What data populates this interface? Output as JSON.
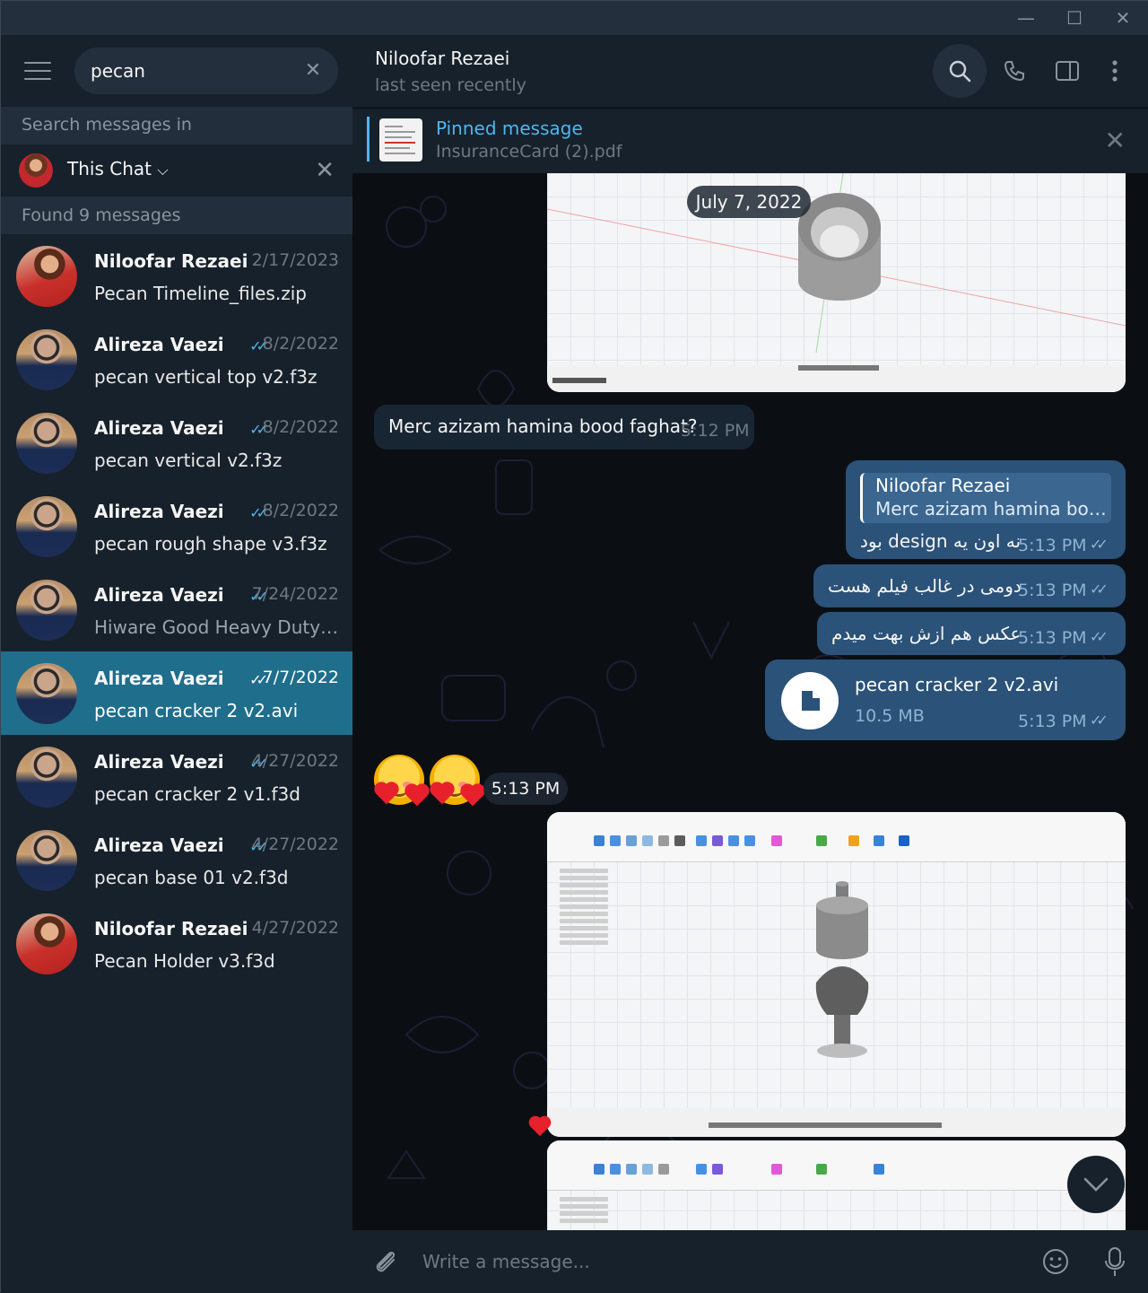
{
  "window": {
    "min": "—",
    "max": "☐",
    "close": "✕"
  },
  "search": {
    "query": "pecan"
  },
  "sidebar": {
    "search_in_label": "Search messages in",
    "scope_label": "This Chat",
    "found_label": "Found 9 messages",
    "results": [
      {
        "name": "Niloofar Rezaei",
        "date": "2/17/2023",
        "text": "Pecan Timeline_files.zip",
        "ticks": "",
        "avatar": "female"
      },
      {
        "name": "Alireza Vaezi",
        "date": "8/2/2022",
        "text": "pecan vertical top v2.f3z",
        "ticks": "✓✓",
        "avatar": "male"
      },
      {
        "name": "Alireza Vaezi",
        "date": "8/2/2022",
        "text": "pecan vertical v2.f3z",
        "ticks": "✓✓",
        "avatar": "male"
      },
      {
        "name": "Alireza Vaezi",
        "date": "8/2/2022",
        "text": "pecan rough shape v3.f3z",
        "ticks": "✓✓",
        "avatar": "male"
      },
      {
        "name": "Alireza Vaezi",
        "date": "7/24/2022",
        "text": "Hiware Good Heavy Duty Pecan Cracker...",
        "ticks": "✓✓",
        "avatar": "male"
      },
      {
        "name": "Alireza Vaezi",
        "date": "7/7/2022",
        "text": "pecan cracker 2 v2.avi",
        "ticks": "✓✓",
        "avatar": "male"
      },
      {
        "name": "Alireza Vaezi",
        "date": "4/27/2022",
        "text": "pecan cracker 2 v1.f3d",
        "ticks": "✓✓",
        "avatar": "male"
      },
      {
        "name": "Alireza Vaezi",
        "date": "4/27/2022",
        "text": "pecan base 01 v2.f3d",
        "ticks": "✓✓",
        "avatar": "male"
      },
      {
        "name": "Niloofar Rezaei",
        "date": "4/27/2022",
        "text": "Pecan Holder v3.f3d",
        "ticks": "",
        "avatar": "female"
      }
    ]
  },
  "chat": {
    "name": "Niloofar Rezaei",
    "status": "last seen recently",
    "pinned": {
      "title": "Pinned message",
      "file": "InsuranceCard (2).pdf"
    },
    "date_separator": "July 7, 2022",
    "messages": {
      "incoming_text": "Merc azizam hamina bood faghat?",
      "incoming_time": "5:12 PM",
      "reply_quote_name": "Niloofar Rezaei",
      "reply_quote_text": "Merc azizam hamina bood faghat?",
      "reply_text": "نه اون یه design بود",
      "reply_time": "5:13 PM",
      "out2_text": "دومی در غالب فیلم هست",
      "out2_time": "5:13 PM",
      "out3_text": "عکس هم ازش بهت میدم",
      "out3_time": "5:13 PM",
      "file_name": "pecan cracker 2 v2.avi",
      "file_size": "10.5 MB",
      "file_time": "5:13 PM",
      "emoji_time": "5:13 PM"
    },
    "composer_placeholder": "Write a message..."
  },
  "colors": {
    "accent": "#4fb6ec",
    "active_row": "#1f6e8c",
    "out_bubble": "#2b5278",
    "in_bubble": "#182533"
  }
}
